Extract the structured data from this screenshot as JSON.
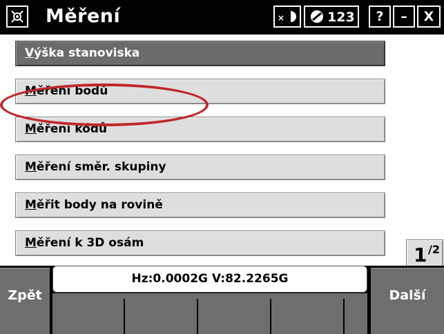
{
  "window": {
    "title": "Měření",
    "icons": {
      "app": "instrument-icon",
      "laser": "laser-pointer-icon",
      "compensator": "compensator-icon"
    },
    "input_mode": "123",
    "help_label": "?",
    "minimize_label": "–",
    "close_label": "X"
  },
  "menu": {
    "items": [
      {
        "accel": "V",
        "rest": "ýška stanoviska",
        "selected": true
      },
      {
        "accel": "M",
        "rest": "ěření bodů",
        "selected": false
      },
      {
        "accel": "M",
        "rest": "ěření kódů",
        "selected": false
      },
      {
        "accel": "M",
        "rest": "ěření směr. skupiny",
        "selected": false
      },
      {
        "accel": "M",
        "rest": "ěřit body na rovině",
        "selected": false
      },
      {
        "accel": "M",
        "rest": "ěření k 3D osám",
        "selected": false
      }
    ],
    "page_current": "1",
    "page_total": "2"
  },
  "status": {
    "readout": "Hz:0.0002G  V:82.2265G"
  },
  "softkeys": {
    "left": "Zpět",
    "right": "Další"
  },
  "colors": {
    "highlight_ring": "#c0262b",
    "button_face": "#dedede",
    "selected_face": "#6b6b6b",
    "softkey_face": "#6e6e6e"
  }
}
